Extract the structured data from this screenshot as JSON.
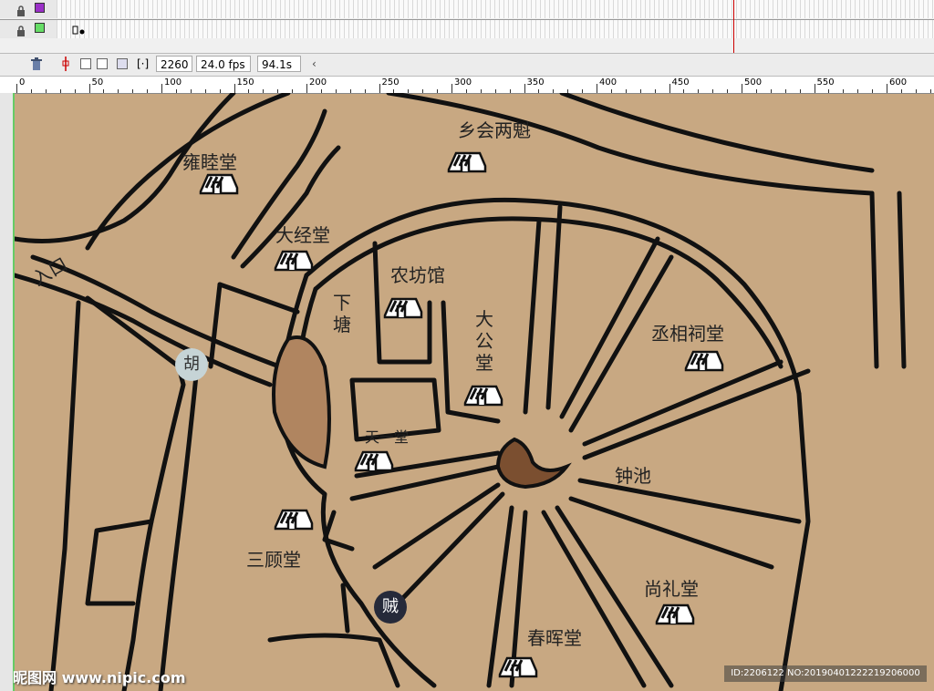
{
  "timeline": {
    "layers": [
      {
        "color": "#9b30c8"
      },
      {
        "color": "#66dd66"
      }
    ],
    "frame_number": "2260",
    "fps": "24.0 fps",
    "time": "94.1s"
  },
  "ruler": {
    "ticks": [
      "0",
      "50",
      "100",
      "150",
      "200",
      "250",
      "300",
      "350",
      "400",
      "450",
      "500",
      "550",
      "600"
    ]
  },
  "map": {
    "background_color": "#c8a882",
    "labels": {
      "rukou": "入口",
      "hu": "胡",
      "yongmutang": "雍睦堂",
      "dajingtang": "大经堂",
      "xianghuiliangkui": "乡会两魁",
      "nongfangguan": "农坊馆",
      "xiatang": "下塘",
      "dagongtang": "大公堂",
      "chengxiangcitang": "丞相祠堂",
      "tianyitang": "天一堂",
      "zhongchi": "钟池",
      "sangutang": "三顾堂",
      "zei": "贼",
      "shanglitang": "尚礼堂",
      "chunhuitang": "春晖堂"
    }
  },
  "watermark": {
    "left": "昵图网 www.nipic.com",
    "right": "ID:2206122 NO:20190401222219206000"
  }
}
